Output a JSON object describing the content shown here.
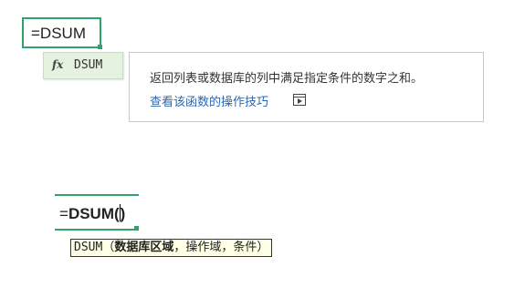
{
  "top_cell": {
    "formula": "=DSUM"
  },
  "suggestion": {
    "icon": "fx",
    "label": "DSUM"
  },
  "tooltip": {
    "description": "返回列表或数据库的列中满足指定条件的数字之和。",
    "link": "查看该函数的操作技巧",
    "link_icon": "video-play-icon"
  },
  "editing_cell": {
    "eq": "=",
    "function_name": "DSUM(",
    "after_caret": ")"
  },
  "arg_hint": {
    "func": "DSUM",
    "open": "（",
    "arg_active": "数据库区域",
    "sep1": "，",
    "arg2": "操作域",
    "sep2": "，",
    "arg3": "条件",
    "close": "）"
  },
  "colors": {
    "selection_green": "#2fa36b",
    "suggestion_bg": "#e4f2df",
    "link_blue": "#2a67b8"
  }
}
